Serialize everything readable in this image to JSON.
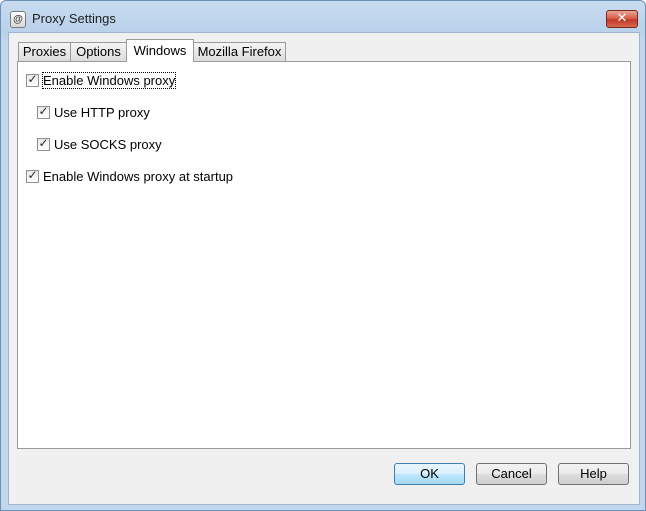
{
  "window": {
    "title": "Proxy Settings",
    "icon": "app-icon",
    "close_glyph": "✕"
  },
  "tabs": [
    {
      "label": "Proxies",
      "active": false
    },
    {
      "label": "Options",
      "active": false
    },
    {
      "label": "Windows",
      "active": true
    },
    {
      "label": "Mozilla Firefox",
      "active": false
    }
  ],
  "options": {
    "enable_windows_proxy": {
      "label": "Enable Windows proxy",
      "checked": true
    },
    "use_http_proxy": {
      "label": "Use HTTP proxy",
      "checked": true
    },
    "use_socks_proxy": {
      "label": "Use SOCKS proxy",
      "checked": true
    },
    "enable_at_startup": {
      "label": "Enable Windows proxy at startup",
      "checked": true
    }
  },
  "buttons": {
    "ok": "OK",
    "cancel": "Cancel",
    "help": "Help"
  },
  "check_glyph": "✓"
}
